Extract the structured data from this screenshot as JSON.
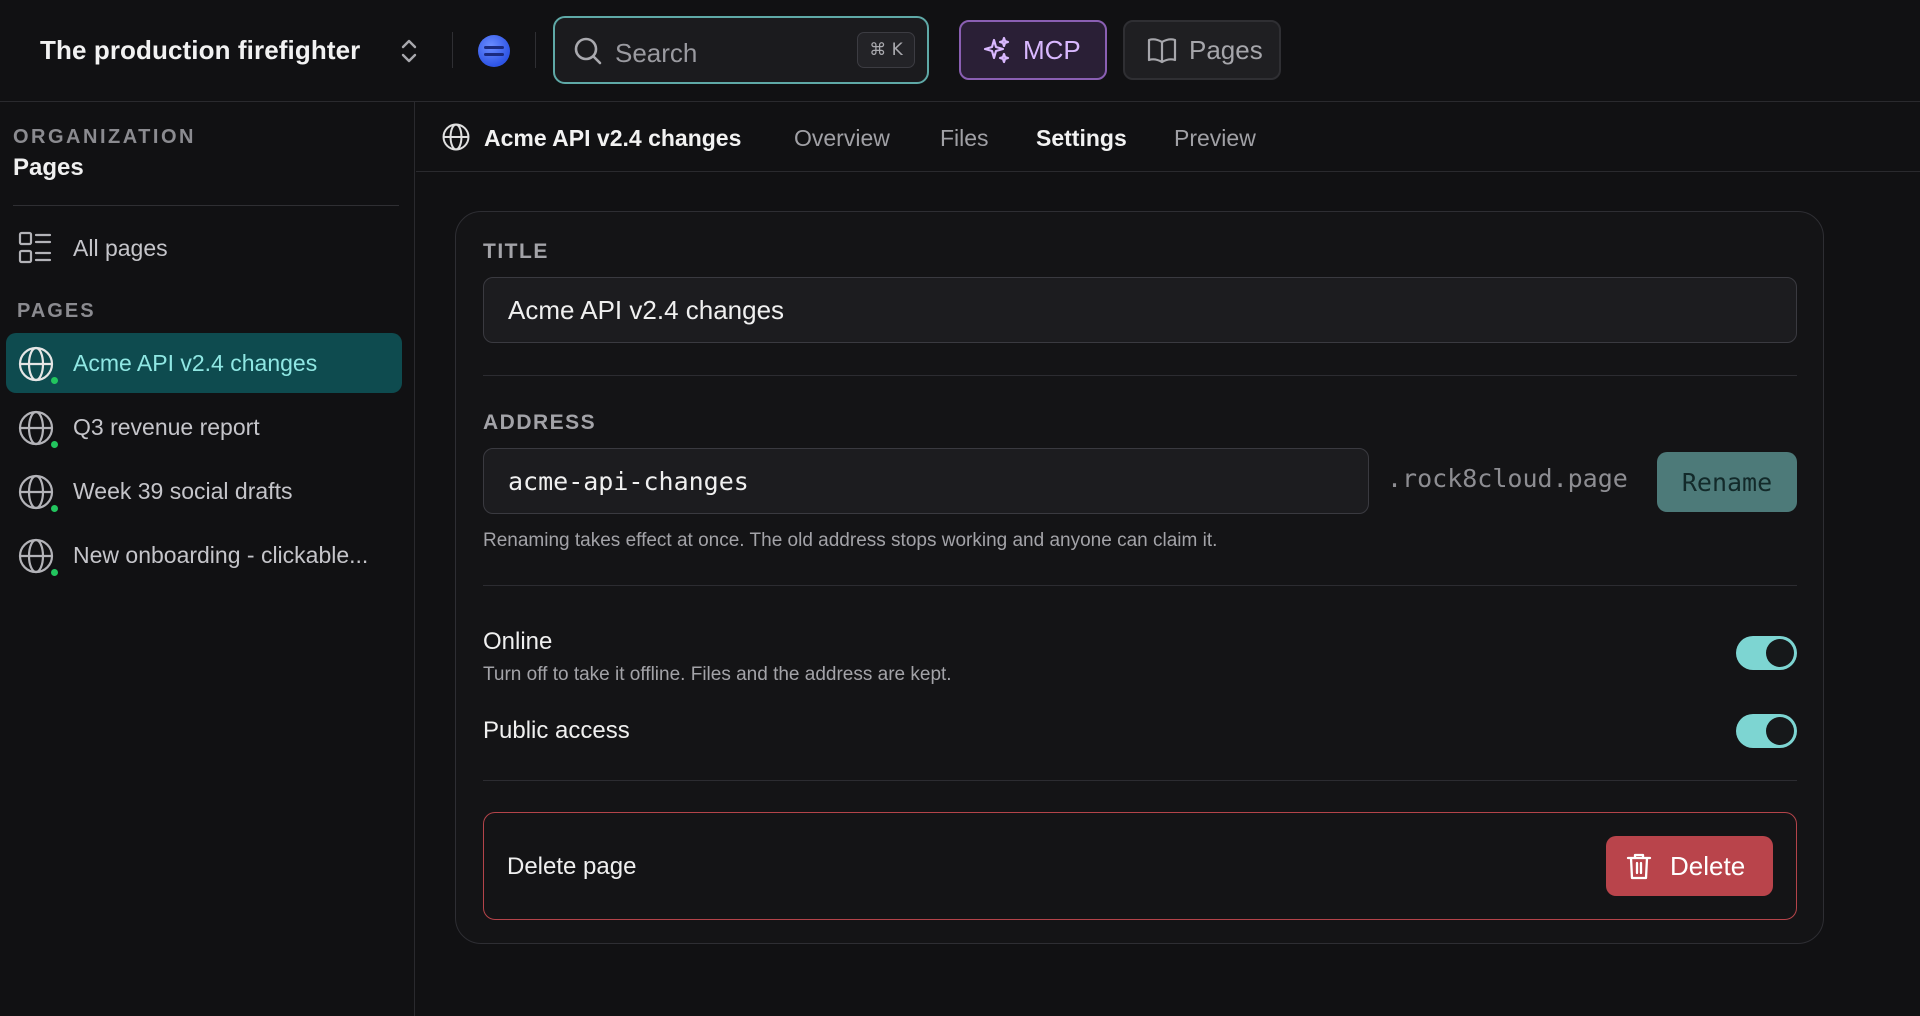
{
  "topbar": {
    "workspace_name": "The production firefighter",
    "search_placeholder": "Search",
    "search_shortcut": "⌘ K",
    "mcp_label": "MCP",
    "pages_label": "Pages"
  },
  "sidebar": {
    "org_label": "ORGANIZATION",
    "org_name": "Pages",
    "all_pages_label": "All pages",
    "section_label": "PAGES",
    "items": [
      {
        "label": "Acme API v2.4 changes",
        "active": true,
        "status": "online"
      },
      {
        "label": "Q3 revenue report",
        "active": false,
        "status": "online"
      },
      {
        "label": "Week 39 social drafts",
        "active": false,
        "status": "online"
      },
      {
        "label": "New onboarding - clickable...",
        "active": false,
        "status": "online"
      }
    ]
  },
  "header": {
    "page_title": "Acme API v2.4 changes",
    "tabs": [
      {
        "label": "Overview",
        "active": false
      },
      {
        "label": "Files",
        "active": false
      },
      {
        "label": "Settings",
        "active": true
      },
      {
        "label": "Preview",
        "active": false
      }
    ]
  },
  "settings": {
    "title_label": "TITLE",
    "title_value": "Acme API v2.4 changes",
    "address_label": "ADDRESS",
    "address_value": "acme-api-changes",
    "address_suffix": ".rock8cloud.page",
    "rename_label": "Rename",
    "address_help": "Renaming takes effect at once. The old address stops working and anyone can claim it.",
    "online_label": "Online",
    "online_help": "Turn off to take it offline. Files and the address are kept.",
    "online_on": true,
    "public_label": "Public access",
    "public_on": true,
    "delete_section_label": "Delete page",
    "delete_label": "Delete"
  },
  "colors": {
    "accent": "#7dd5d2",
    "active_nav_bg": "#0e4b4f",
    "danger": "#b9444b",
    "mcp": "#d9b8ff",
    "online_dot": "#22c55e"
  }
}
